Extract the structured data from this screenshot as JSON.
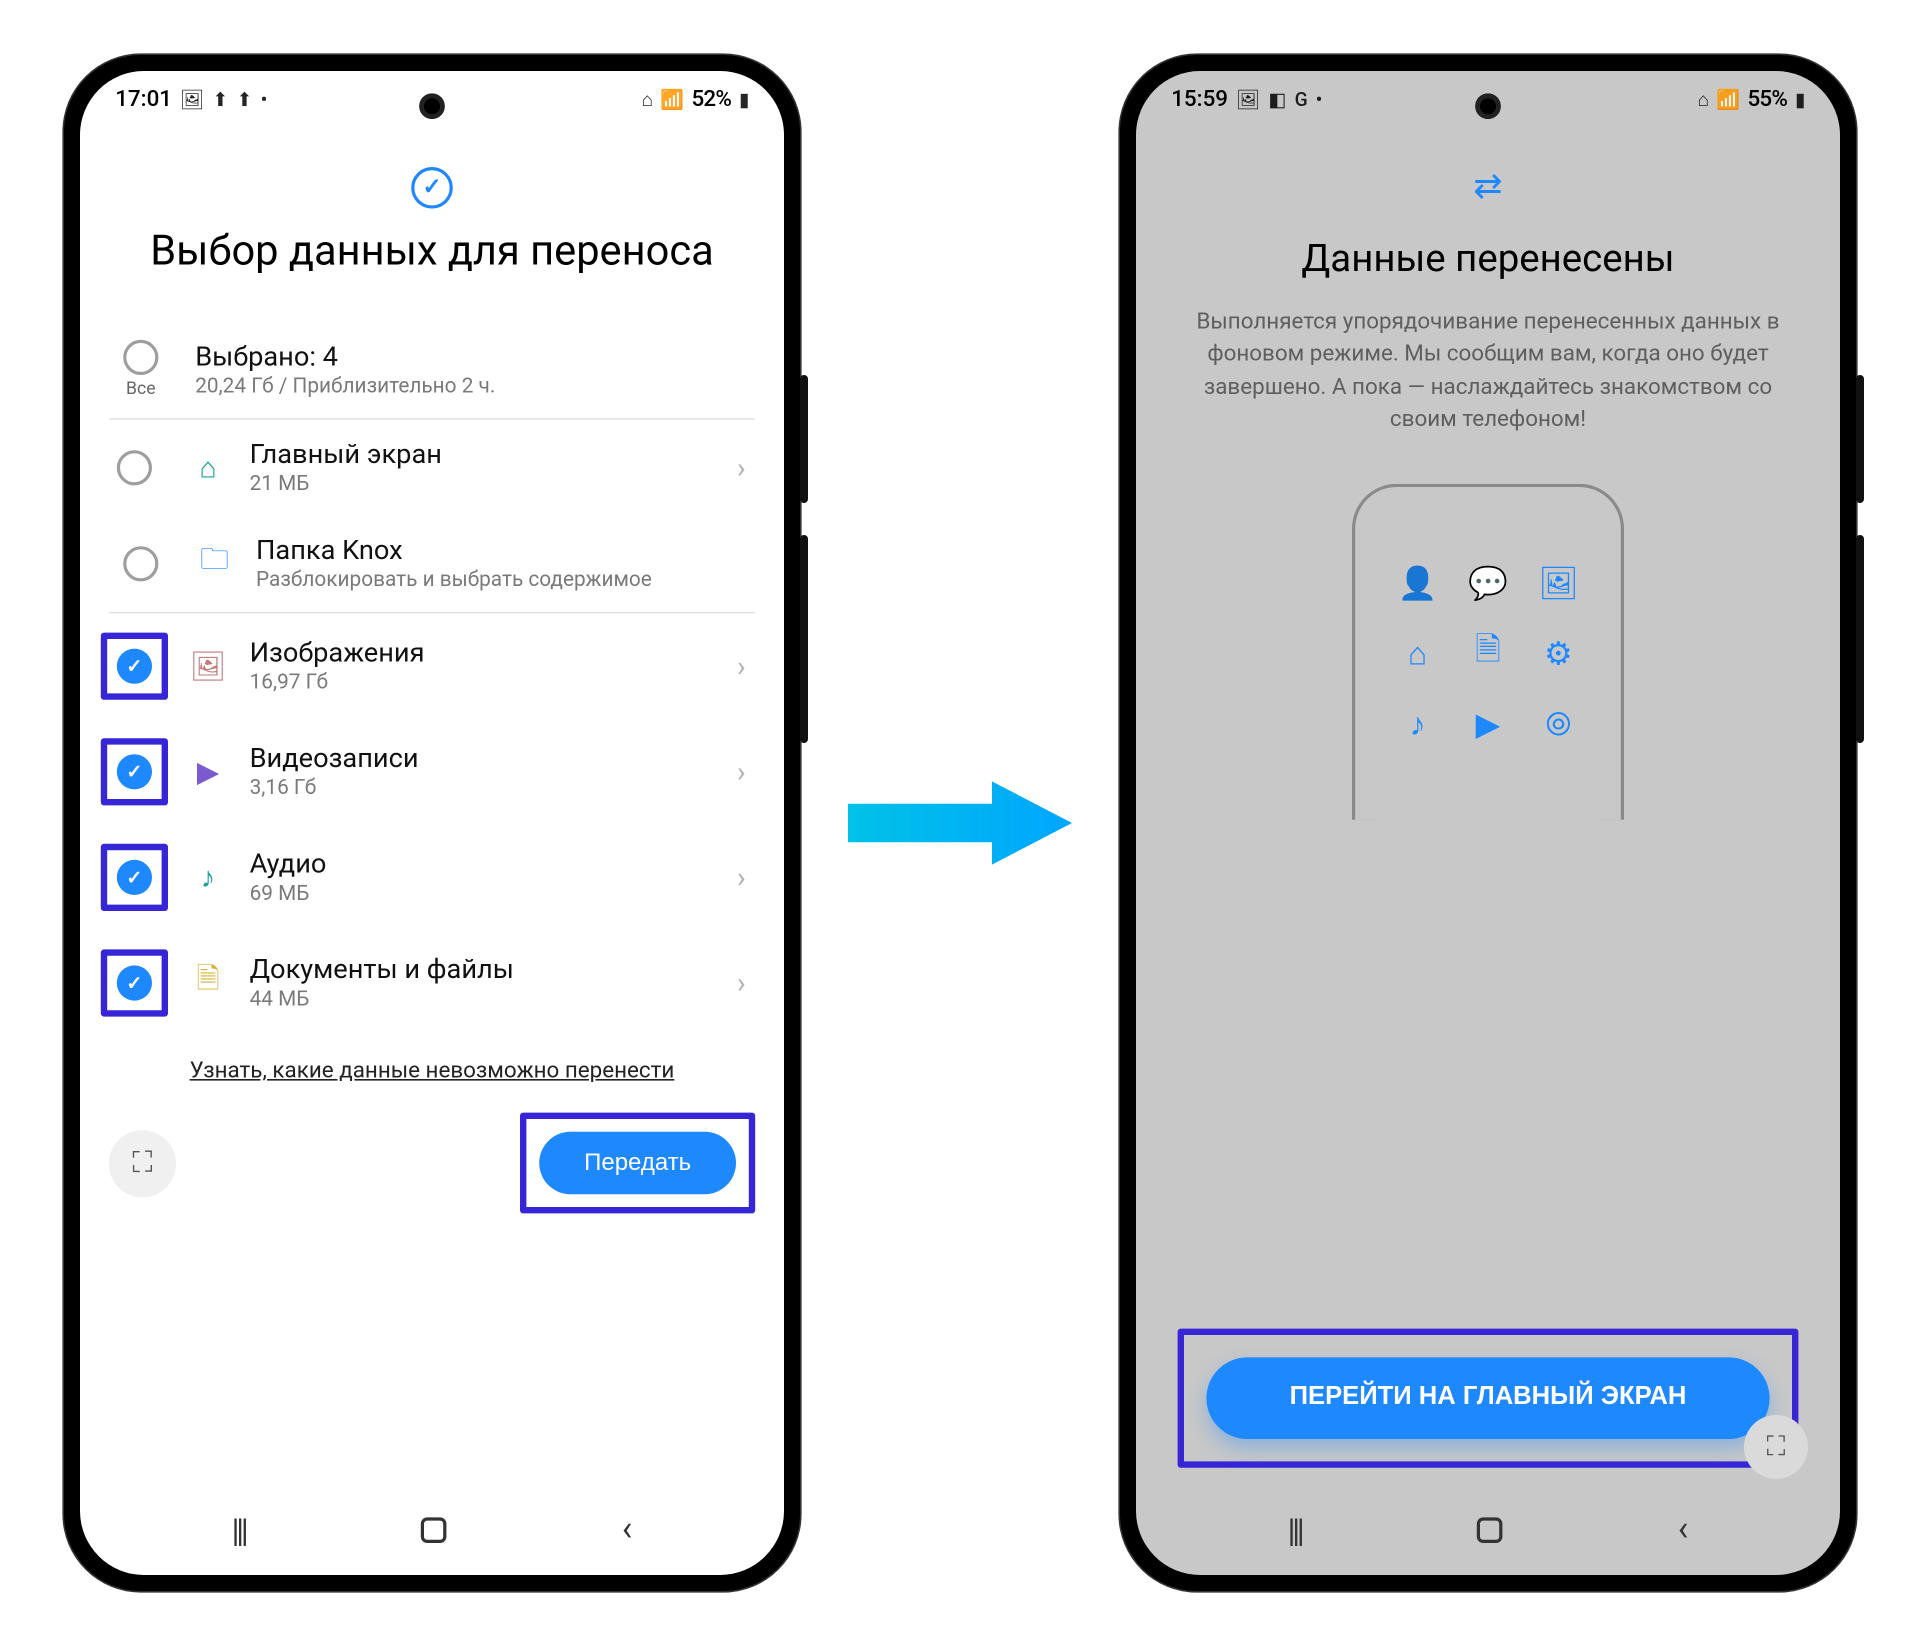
{
  "colors": {
    "accent": "#1e88ff",
    "highlight": "#3726d6"
  },
  "left": {
    "statusbar": {
      "time": "17:01",
      "left_icons": [
        "🖼",
        "⬆",
        "⬆",
        "•"
      ],
      "right_icons": [
        "⌂",
        "📶"
      ],
      "battery": "52%",
      "battery_icon": "▮"
    },
    "title": "Выбор данных для переноса",
    "summary": {
      "all_label": "Все",
      "selected": "Выбрано: 4",
      "subtitle": "20,24 Гб / Приблизительно 2 ч."
    },
    "items": [
      {
        "checked": false,
        "highlighted": false,
        "icon": "⌂",
        "icon_name": "home-icon",
        "icon_color": "#1aa39a",
        "title": "Главный экран",
        "subtitle": "21 МБ",
        "chevron": true
      },
      {
        "checked": false,
        "highlighted": false,
        "icon": "🗀",
        "icon_name": "folder-icon",
        "icon_color": "#1e88ff",
        "title": "Папка Knox",
        "subtitle": "Разблокировать и выбрать содержимое",
        "chevron": false
      },
      {
        "checked": true,
        "highlighted": true,
        "icon": "🖼",
        "icon_name": "image-icon",
        "icon_color": "#c27a7a",
        "title": "Изображения",
        "subtitle": "16,97 Гб",
        "chevron": true
      },
      {
        "checked": true,
        "highlighted": true,
        "icon": "▶",
        "icon_name": "video-icon",
        "icon_color": "#7a5bd0",
        "title": "Видеозаписи",
        "subtitle": "3,16 Гб",
        "chevron": true
      },
      {
        "checked": true,
        "highlighted": true,
        "icon": "♪",
        "icon_name": "audio-icon",
        "icon_color": "#1aa39a",
        "title": "Аудио",
        "subtitle": "69 МБ",
        "chevron": true
      },
      {
        "checked": true,
        "highlighted": true,
        "icon": "🗎",
        "icon_name": "document-icon",
        "icon_color": "#d6b23a",
        "title": "Документы и файлы",
        "subtitle": "44 МБ",
        "chevron": true
      }
    ],
    "cannot_transfer_link": "Узнать, какие данные невозможно перенести",
    "send_button": "Передать"
  },
  "right": {
    "statusbar": {
      "time": "15:59",
      "left_icons": [
        "🖼",
        "◧",
        "G",
        "•"
      ],
      "right_icons": [
        "⌂",
        "📶"
      ],
      "battery": "55%",
      "battery_icon": "▮"
    },
    "title": "Данные перенесены",
    "description": "Выполняется упорядочивание перенесенных данных в фоновом режиме. Мы сообщим вам, когда оно будет завершено. А пока — наслаждайтесь знакомством со своим телефоном!",
    "grid_icons": [
      "👤",
      "💬",
      "🖼",
      "⌂",
      "🗎",
      "⚙",
      "♪",
      "▶",
      "⦾"
    ],
    "go_button": "ПЕРЕЙТИ НА ГЛАВНЫЙ ЭКРАН"
  }
}
